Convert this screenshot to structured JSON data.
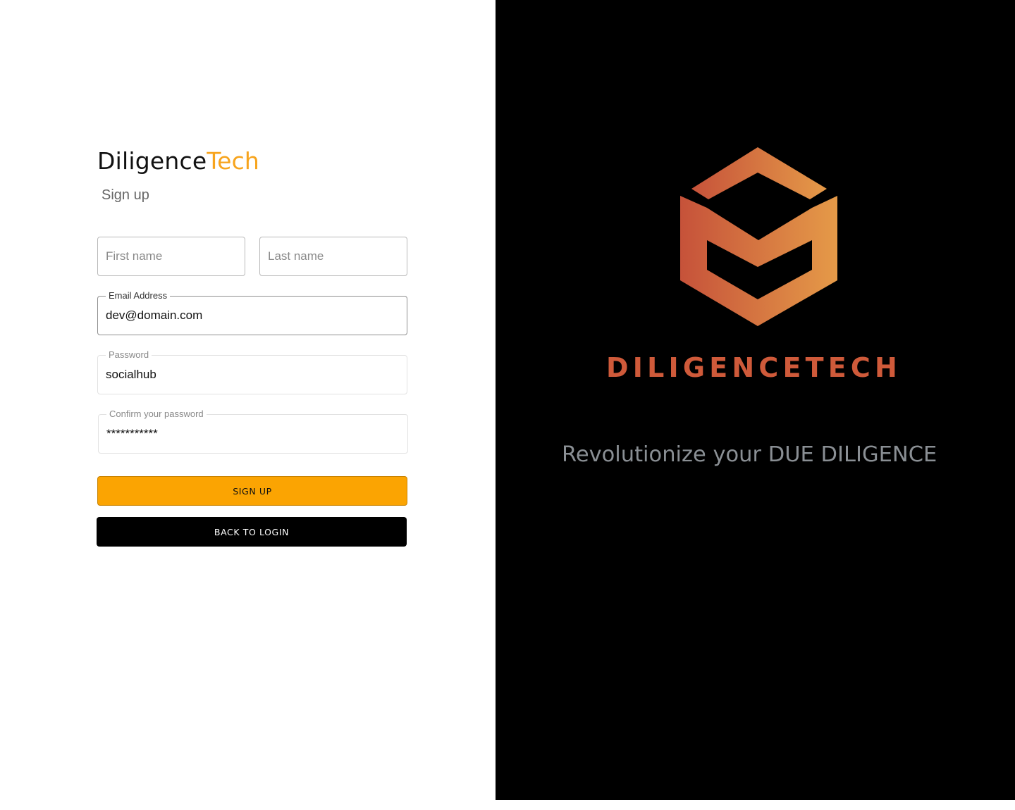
{
  "brand": {
    "name_main": "Diligence",
    "name_accent": "Tech",
    "accent_color": "#f7a41d"
  },
  "form": {
    "title": "Sign up",
    "first_name": {
      "placeholder": "First name",
      "value": ""
    },
    "last_name": {
      "placeholder": "Last name",
      "value": ""
    },
    "email": {
      "label": "Email Address",
      "value": "dev@domain.com"
    },
    "password": {
      "label": "Password",
      "value": "socialhub"
    },
    "confirm_password": {
      "label": "Confirm your password",
      "value": "***********"
    },
    "signup_button": "SIGN UP",
    "back_button": "BACK TO LOGIN",
    "signup_color": "#fba402"
  },
  "hero": {
    "logo_icon": "diligencetech-cube-logo",
    "logo_text": "DILIGENCETECH",
    "tagline": "Revolutionize your DUE DILIGENCE",
    "logo_color": "#cf5a3a",
    "background": "#000000"
  }
}
